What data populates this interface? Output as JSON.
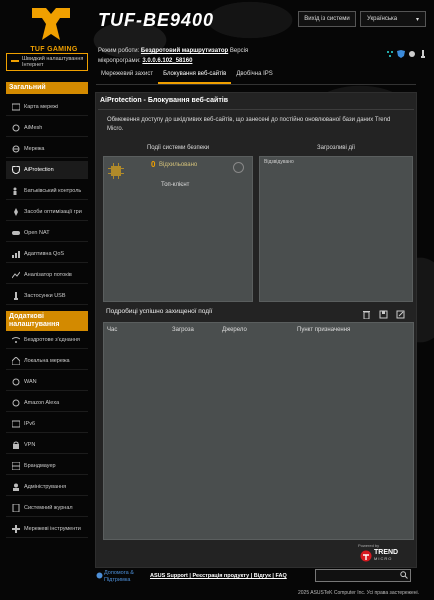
{
  "brand": {
    "logo_text": "TUF GAMING",
    "model": "TUF-BE9400"
  },
  "header": {
    "logout_label": "Вихід із системи",
    "language": "Українська"
  },
  "status": {
    "mode_label": "Режим роботи:",
    "mode_value": "Бездротовий маршрутизатор",
    "version_label": "Версія",
    "firmware_label": "мікропрограми:",
    "firmware_value": "3.0.0.6.102_58160"
  },
  "tabs": [
    {
      "label": "Мережевий захист"
    },
    {
      "label": "Блокування веб-сайтів"
    },
    {
      "label": "Двобічна IPS"
    }
  ],
  "sidebar": {
    "qis_label": "Швидкий налаштування Інтернет",
    "section_general": "Загальний",
    "general_items": [
      {
        "label": "Карта мережі"
      },
      {
        "label": "AiMesh"
      },
      {
        "label": "Мережа"
      },
      {
        "label": "AiProtection"
      },
      {
        "label": "Батьківський контроль"
      },
      {
        "label": "Засоби оптимізації гри"
      },
      {
        "label": "Open NAT"
      },
      {
        "label": "Адаптивна QoS"
      },
      {
        "label": "Аналізатор потоків"
      },
      {
        "label": "Застосунки USB"
      }
    ],
    "section_advanced": "Додаткові налаштування",
    "advanced_items": [
      {
        "label": "Бездротове з'єднання"
      },
      {
        "label": "Локальна мережа"
      },
      {
        "label": "WAN"
      },
      {
        "label": "Amazon Alexa"
      },
      {
        "label": "IPv6"
      },
      {
        "label": "VPN"
      },
      {
        "label": "Брандмауер"
      },
      {
        "label": "Адміністрування"
      },
      {
        "label": "Системний журнал"
      },
      {
        "label": "Мережеві інструменти"
      }
    ]
  },
  "main": {
    "title": "AiProtection - Блокування веб-сайтів",
    "description": "Обмеження доступу до шкідливих веб-сайтів, що занесені до постійно оновлюваної бази даних Trend Micro.",
    "events_header": "Події системи безпеки",
    "threats_header": "Загрозливі дії",
    "blocked_count": "0",
    "blocked_label": "Відхильовано",
    "top_client_label": "Топ-клієнт",
    "reported_label": "Відзвідувано",
    "details_header": "Подробиці успішно захищеної події",
    "table_columns": [
      "Час",
      "Загроза",
      "Джерело",
      "Пункт призначення"
    ],
    "powered_by": "Powered by",
    "trend_name": "TREND",
    "trend_sub": "MICRO"
  },
  "footer": {
    "help_line1": "Допомога &",
    "help_line2": "Підтримка",
    "links": "ASUS Support | Реєстрація продукту | Відгук | FAQ",
    "copyright": "2025 ASUSTeK Computer Inc. Усі права застережені."
  },
  "colors": {
    "accent": "#f0a000",
    "panel": "#232323",
    "box": "#4a4e4e"
  }
}
